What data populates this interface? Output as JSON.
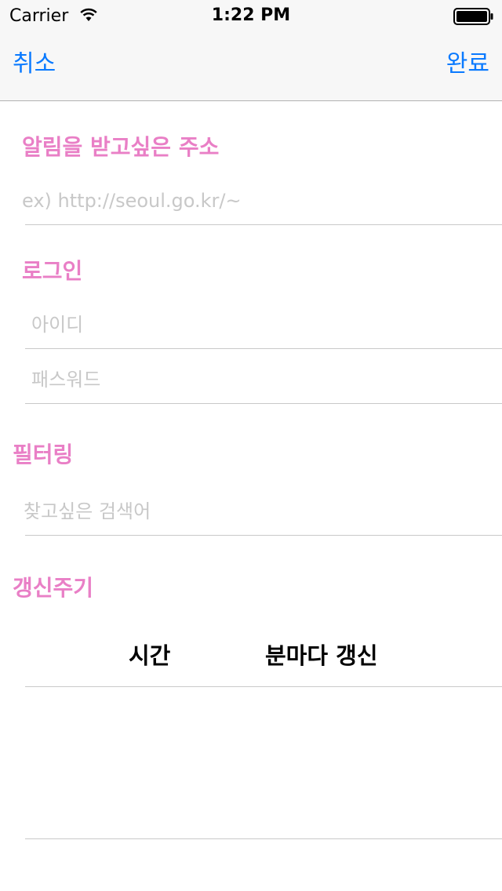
{
  "status_bar": {
    "carrier": "Carrier",
    "time": "1:22 PM"
  },
  "nav": {
    "cancel_label": "취소",
    "done_label": "완료"
  },
  "sections": {
    "address": {
      "title": "알림을 받고싶은 주소",
      "placeholder": "ex) http://seoul.go.kr/~",
      "value": ""
    },
    "login": {
      "title": "로그인",
      "id_placeholder": "아이디",
      "password_placeholder": "패스워드",
      "id_value": "",
      "password_value": ""
    },
    "filtering": {
      "title": "필터링",
      "placeholder": "찾고싶은 검색어",
      "value": ""
    },
    "interval": {
      "title": "갱신주기",
      "unit_label": "시간",
      "suffix_label": "분마다 갱신"
    }
  },
  "colors": {
    "accent": "#0a7aff",
    "section_title": "#e97fc6",
    "placeholder": "#c8c8c8",
    "divider": "#c9c9c9"
  },
  "icons": {
    "wifi": "wifi-icon",
    "battery": "battery-icon"
  }
}
